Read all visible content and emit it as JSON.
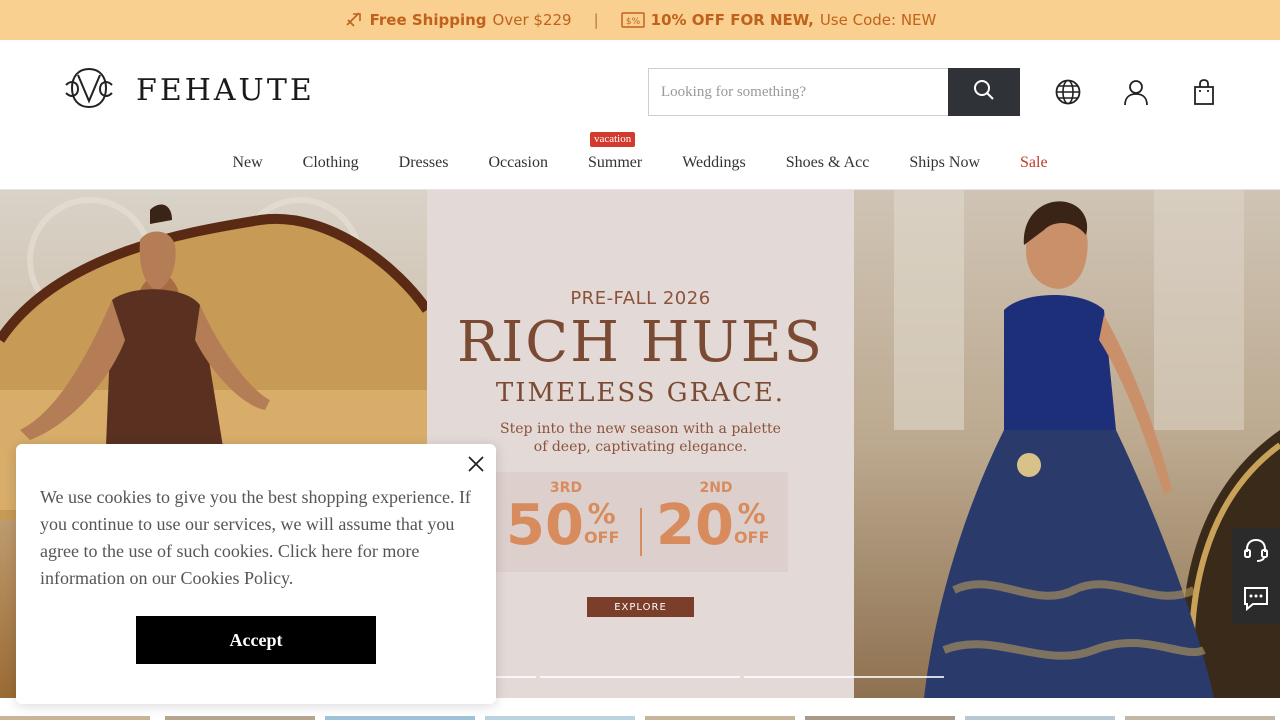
{
  "promo": {
    "shipping_bold": "Free Shipping",
    "shipping_rest": "Over $229",
    "separator": "|",
    "discount_bold": "10% OFF FOR NEW,",
    "discount_rest": "Use Code: NEW",
    "color": "#c0621c",
    "background": "#f9d08f"
  },
  "header": {
    "logo_text": "FEHAUTE",
    "search_placeholder": "Looking for something?",
    "icons": [
      "search-icon",
      "globe-icon",
      "user-icon",
      "shopping-bag-icon"
    ]
  },
  "nav": {
    "items": [
      {
        "label": "New"
      },
      {
        "label": "Clothing"
      },
      {
        "label": "Dresses"
      },
      {
        "label": "Occasion"
      },
      {
        "label": "Summer",
        "badge": "vacation"
      },
      {
        "label": "Weddings"
      },
      {
        "label": "Shoes & Acc"
      },
      {
        "label": "Ships Now"
      },
      {
        "label": "Sale"
      }
    ]
  },
  "hero": {
    "pre_title": "PRE-FALL 2026",
    "title": "RICH HUES",
    "subtitle": "TIMELESS GRACE.",
    "desc_line1": "Step into the new season with a palette",
    "desc_line2": "of deep, captivating elegance.",
    "offer1_label": "3RD",
    "offer1_value": "50",
    "offer1_pct": "%",
    "offer1_off": "OFF",
    "offer2_label": "2ND",
    "offer2_value": "20",
    "offer2_pct": "%",
    "offer2_off": "OFF",
    "cta": "EXPLORE",
    "text_color": "#7b4a33",
    "offer_color": "#d88c5e"
  },
  "side_widgets": [
    "headset-support-icon",
    "chat-icon"
  ],
  "cookie": {
    "text": "We use cookies to give you the best shopping experience. If you continue to use our services, we will assume that you agree to the use of such cookies. Click here for more information on our Cookies Policy.",
    "accept_label": "Accept"
  }
}
